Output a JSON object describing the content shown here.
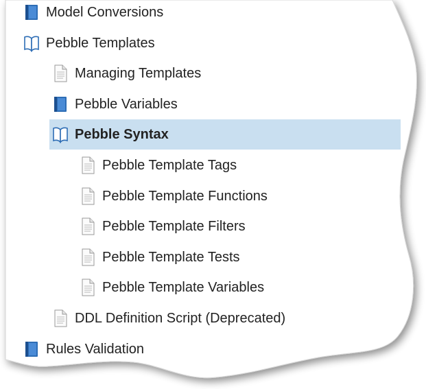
{
  "tree": {
    "items": [
      {
        "label": "Model Conversions",
        "icon": "closed-book-icon",
        "level": 0,
        "selected": false
      },
      {
        "label": "Pebble Templates",
        "icon": "open-book-icon",
        "level": 0,
        "selected": false
      },
      {
        "label": "Managing Templates",
        "icon": "document-icon",
        "level": 1,
        "selected": false
      },
      {
        "label": "Pebble Variables",
        "icon": "closed-book-icon",
        "level": 1,
        "selected": false
      },
      {
        "label": "Pebble Syntax",
        "icon": "open-book-icon",
        "level": 1,
        "selected": true
      },
      {
        "label": "Pebble Template Tags",
        "icon": "document-icon",
        "level": 2,
        "selected": false
      },
      {
        "label": "Pebble Template Functions",
        "icon": "document-icon",
        "level": 2,
        "selected": false
      },
      {
        "label": "Pebble Template Filters",
        "icon": "document-icon",
        "level": 2,
        "selected": false
      },
      {
        "label": "Pebble Template Tests",
        "icon": "document-icon",
        "level": 2,
        "selected": false
      },
      {
        "label": "Pebble Template Variables",
        "icon": "document-icon",
        "level": 2,
        "selected": false
      },
      {
        "label": "DDL Definition Script (Deprecated)",
        "icon": "document-icon",
        "level": 1,
        "selected": false
      },
      {
        "label": "Rules Validation",
        "icon": "closed-book-icon",
        "level": 0,
        "selected": false,
        "partially_obscured": true
      }
    ]
  },
  "colors": {
    "selection_bg": "#c9dff0",
    "book_blue": "#2d6db5",
    "text": "#222222"
  }
}
